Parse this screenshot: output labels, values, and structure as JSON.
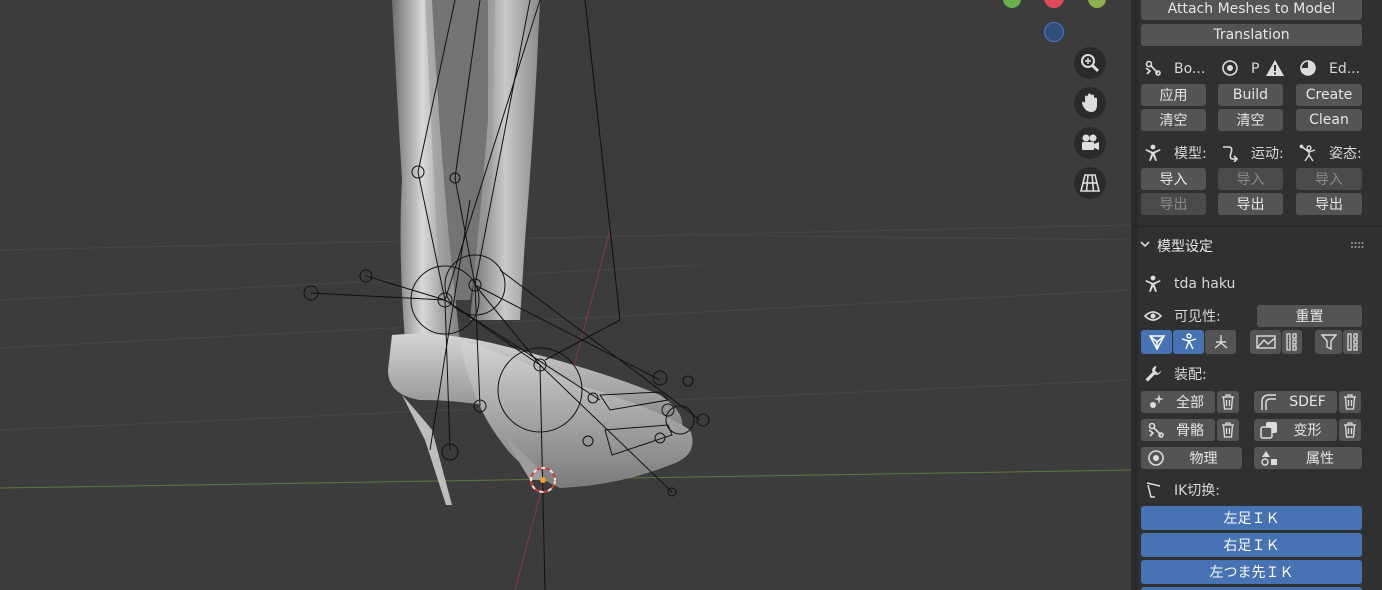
{
  "panel": {
    "buttons_top": {
      "attach_meshes": "Attach Meshes to Model",
      "translation": "Translation"
    },
    "tools_row": {
      "bone_label": "Bo...",
      "physics_label": "P",
      "edit_label": "Ed...",
      "apply": "应用",
      "build": "Build",
      "create": "Create",
      "clear1": "清空",
      "clear2": "清空",
      "clean": "Clean"
    },
    "io_row": {
      "model_label": "模型:",
      "motion_label": "运动:",
      "pose_label": "姿态:",
      "import1": "导入",
      "import2": "导入",
      "import3": "导入",
      "export1": "导出",
      "export2": "导出",
      "export3": "导出"
    },
    "model_settings": {
      "header": "模型设定",
      "model_name": "tda haku",
      "visibility_label": "可见性:",
      "reset": "重置",
      "rig_label": "装配:",
      "all": "全部",
      "sdef": "SDEF",
      "bone": "骨骼",
      "morph": "变形",
      "physics": "物理",
      "properties": "属性",
      "ik_label": "IK切换:",
      "ik_items": [
        "左足ＩＫ",
        "右足ＩＫ",
        "左つま先ＩＫ"
      ]
    }
  },
  "viewport": {
    "gizmo_icons": [
      "zoom-icon",
      "hand-pan-icon",
      "camera-icon",
      "perspective-grid-icon"
    ],
    "colors": {
      "axis_red": "#e04a5a",
      "axis_green": "#6ab04c",
      "axis_blue": "#4a78c8",
      "accent_blue": "#4772b3"
    }
  }
}
